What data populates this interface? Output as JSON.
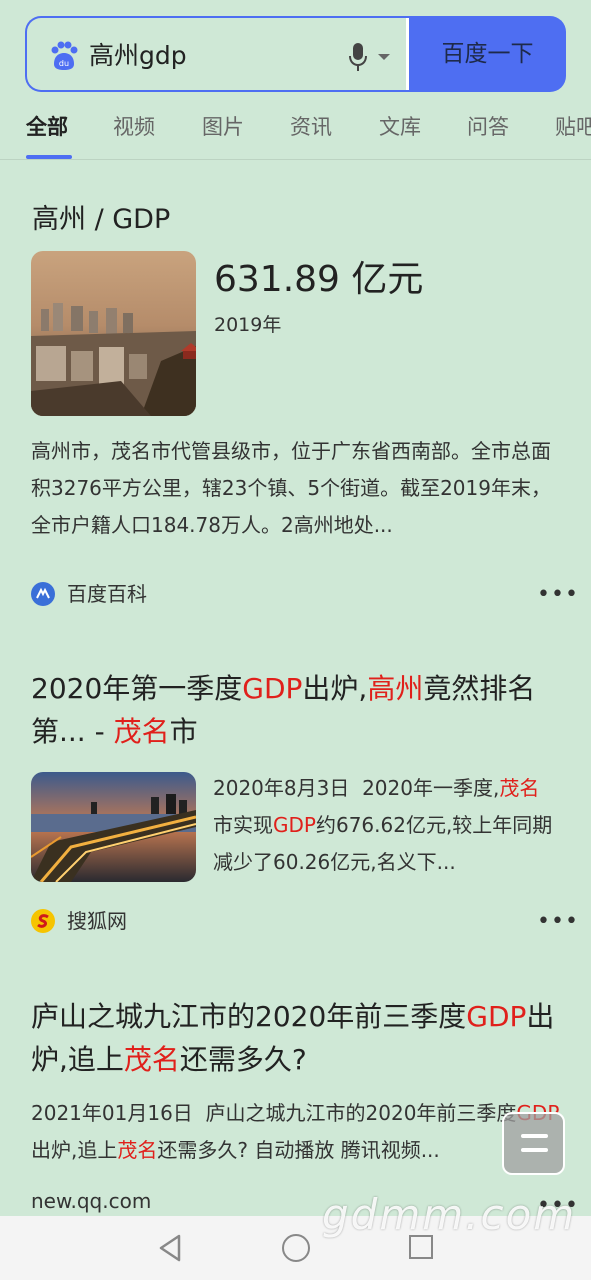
{
  "search": {
    "query": "高州gdp",
    "button_label": "百度一下",
    "accent_color": "#4e6ef2"
  },
  "tabs": [
    {
      "label": "全部",
      "active": true
    },
    {
      "label": "视频"
    },
    {
      "label": "图片"
    },
    {
      "label": "资讯"
    },
    {
      "label": "文库"
    },
    {
      "label": "问答"
    },
    {
      "label": "贴吧"
    }
  ],
  "knowledge_card": {
    "title": "高州 / GDP",
    "value": "631.89 亿元",
    "year": "2019年",
    "image_icon": "city-skyline-photo",
    "description": "高州市，茂名市代管县级市，位于广东省西南部。全市总面积3276平方公里，辖23个镇、5个街道。截至2019年末，全市户籍人口184.78万人。2高州地处...",
    "source": "百度百科",
    "source_icon": "baike-icon"
  },
  "results": [
    {
      "title_parts": [
        {
          "text": "2020年第一季度"
        },
        {
          "text": "GDP",
          "hl": true
        },
        {
          "text": "出炉,"
        },
        {
          "text": "高州",
          "hl": true
        },
        {
          "text": "竟然排名第... - "
        },
        {
          "text": "茂名",
          "hl": true
        },
        {
          "text": "市"
        }
      ],
      "image_icon": "city-night-bridge-photo",
      "date": "2020年8月3日",
      "snippet_parts": [
        {
          "text": "2020年一季度,"
        },
        {
          "text": "茂名",
          "hl": true
        },
        {
          "text": "市实现"
        },
        {
          "text": "GDP",
          "hl": true
        },
        {
          "text": "约676.62亿元,较上年同期减少了60.26亿元,名义下..."
        }
      ],
      "source": "搜狐网",
      "source_icon": "sohu-icon"
    },
    {
      "title_parts": [
        {
          "text": "庐山之城九江市的2020年前三季度"
        },
        {
          "text": "GDP",
          "hl": true
        },
        {
          "text": "出炉,追上"
        },
        {
          "text": "茂名",
          "hl": true
        },
        {
          "text": "还需多久?"
        }
      ],
      "date": "2021年01月16日",
      "snippet_parts": [
        {
          "text": "庐山之城九江市的2020年前三季度"
        },
        {
          "text": "GDP",
          "hl": true
        },
        {
          "text": "出炉,追上"
        },
        {
          "text": "茂名",
          "hl": true
        },
        {
          "text": "还需多久? 自动播放 腾讯视频..."
        }
      ],
      "url": "new.qq.com"
    }
  ],
  "more_label": "•••",
  "watermark": "gdmm.com",
  "nav": {
    "back_icon": "back-triangle-icon",
    "home_icon": "home-circle-icon",
    "recent_icon": "recent-square-icon"
  }
}
